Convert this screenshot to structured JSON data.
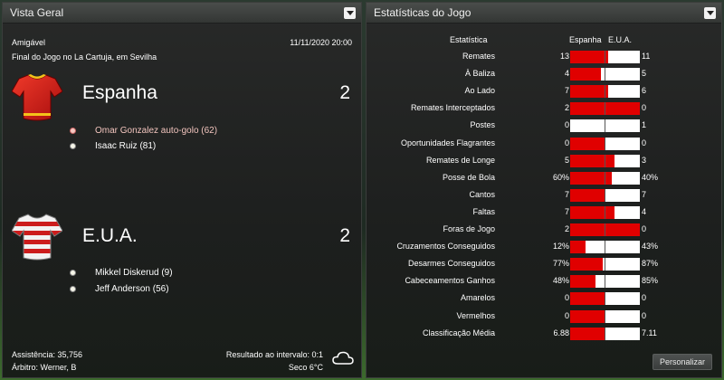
{
  "overview": {
    "title": "Vista Geral",
    "competition": "Amigável",
    "date": "11/11/2020 20:00",
    "venue": "Final do Jogo no La Cartuja, em Sevilha",
    "home": {
      "name": "Espanha",
      "score": "2",
      "shirt_color": "#d01818",
      "scorers": [
        {
          "text": "Omar Gonzalez auto-golo (62)",
          "own_goal": true
        },
        {
          "text": "Isaac Ruiz (81)",
          "own_goal": false
        }
      ]
    },
    "away": {
      "name": "E.U.A.",
      "score": "2",
      "shirt_color": "#c81818",
      "scorers": [
        {
          "text": "Mikkel Diskerud (9)",
          "own_goal": false
        },
        {
          "text": "Jeff Anderson (56)",
          "own_goal": false
        }
      ]
    },
    "attendance": "Assistência: 35,756",
    "referee": "Árbitro: Werner, B",
    "half_time": "Resultado ao intervalo: 0:1",
    "weather": "Seco 6°C",
    "weather_icon": "cloud-icon"
  },
  "stats": {
    "title": "Estatísticas do Jogo",
    "header_stat": "Estatística",
    "header_home": "Espanha",
    "header_away": "E.U.A.",
    "accent_color": "#e00000",
    "rows": [
      {
        "label": "Remates",
        "home": "13",
        "away": "11",
        "home_share": 0.54
      },
      {
        "label": "À Baliza",
        "home": "4",
        "away": "5",
        "home_share": 0.44
      },
      {
        "label": "Ao Lado",
        "home": "7",
        "away": "6",
        "home_share": 0.54
      },
      {
        "label": "Remates Interceptados",
        "home": "2",
        "away": "0",
        "home_share": 1.0
      },
      {
        "label": "Postes",
        "home": "0",
        "away": "1",
        "home_share": 0.0
      },
      {
        "label": "Oportunidades Flagrantes",
        "home": "0",
        "away": "0",
        "home_share": 0.5
      },
      {
        "label": "Remates de Longe",
        "home": "5",
        "away": "3",
        "home_share": 0.63
      },
      {
        "label": "Posse de Bola",
        "home": "60%",
        "away": "40%",
        "home_share": 0.6
      },
      {
        "label": "Cantos",
        "home": "7",
        "away": "7",
        "home_share": 0.5
      },
      {
        "label": "Faltas",
        "home": "7",
        "away": "4",
        "home_share": 0.64
      },
      {
        "label": "Foras de Jogo",
        "home": "2",
        "away": "0",
        "home_share": 1.0
      },
      {
        "label": "Cruzamentos Conseguidos",
        "home": "12%",
        "away": "43%",
        "home_share": 0.22
      },
      {
        "label": "Desarmes Conseguidos",
        "home": "77%",
        "away": "87%",
        "home_share": 0.47
      },
      {
        "label": "Cabeceamentos Ganhos",
        "home": "48%",
        "away": "85%",
        "home_share": 0.36
      },
      {
        "label": "Amarelos",
        "home": "0",
        "away": "0",
        "home_share": 0.5
      },
      {
        "label": "Vermelhos",
        "home": "0",
        "away": "0",
        "home_share": 0.5
      },
      {
        "label": "Classificação Média",
        "home": "6.88",
        "away": "7.11",
        "home_share": 0.49
      }
    ],
    "customize_label": "Personalizar"
  }
}
